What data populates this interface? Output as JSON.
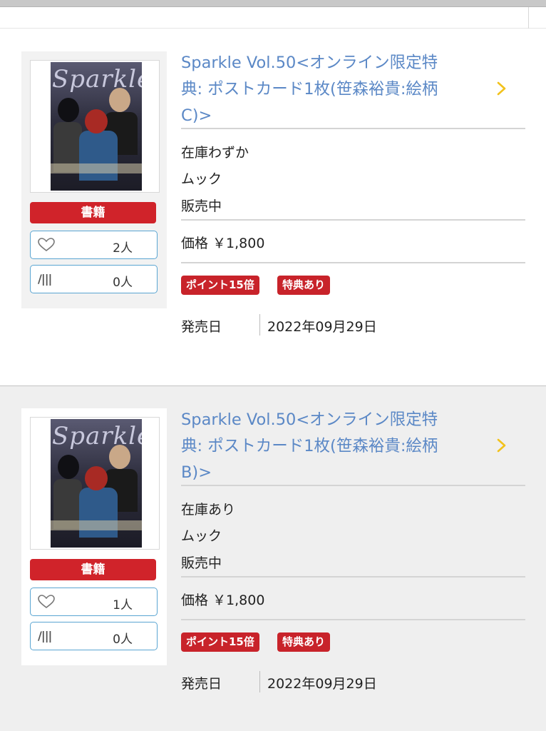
{
  "items": [
    {
      "cover_title": "Sparkle",
      "category": "書籍",
      "likes": "2人",
      "shelf": "0人",
      "title_lines": [
        "Sparkle Vol.50<オンライン限定特",
        "典: ポストカード1枚(笹森裕貴:絵柄",
        "C)>"
      ],
      "stock": "在庫わずか",
      "format": "ムック",
      "status": "販売中",
      "price": "価格 ￥1,800",
      "tags": [
        "ポイント15倍",
        "特典あり"
      ],
      "release_label": "発売日",
      "release_date": "2022年09月29日"
    },
    {
      "cover_title": "Sparkle",
      "category": "書籍",
      "likes": "1人",
      "shelf": "0人",
      "title_lines": [
        "Sparkle Vol.50<オンライン限定特",
        "典: ポストカード1枚(笹森裕貴:絵柄",
        "B)>"
      ],
      "stock": "在庫あり",
      "format": "ムック",
      "status": "販売中",
      "price": "価格 ￥1,800",
      "tags": [
        "ポイント15倍",
        "特典あり"
      ],
      "release_label": "発売日",
      "release_date": "2022年09月29日"
    }
  ],
  "icons": {
    "like": "heart-outline-icon",
    "shelf": "bookshelf-icon",
    "shelf_glyph": "/|||",
    "chevron": "chevron-right-icon"
  },
  "colors": {
    "link": "#5b88c6",
    "badge_red": "#d0232a",
    "border_blue": "#5aa5d2",
    "chevron_yellow": "#f2c21c"
  }
}
